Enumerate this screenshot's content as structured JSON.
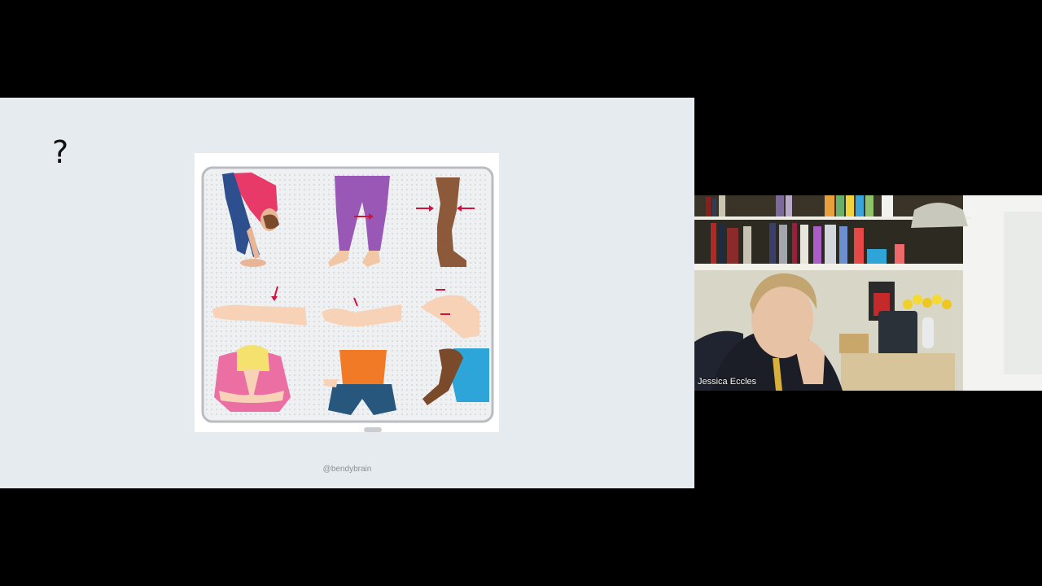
{
  "slide": {
    "heading": "?",
    "credit": "@bendybrain"
  },
  "video": {
    "participant_name": "Jessica Eccles"
  }
}
